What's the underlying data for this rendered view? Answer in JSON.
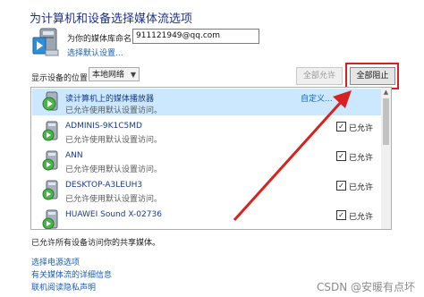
{
  "window": {
    "title": "为计算机和设备选择媒体流选项"
  },
  "library": {
    "name_label": "为你的媒体库命名:",
    "name_value": "911121949@qq.com",
    "default_link": "选择默认设置..."
  },
  "location": {
    "label": "显示设备的位置:",
    "selected": "本地网络"
  },
  "buttons": {
    "allow_all": "全部允许",
    "block_all": "全部阻止"
  },
  "devices": [
    {
      "name": "读计算机上的媒体播放器",
      "status": "已允许使用默认设置访问。",
      "action": "自定义...",
      "selected": true
    },
    {
      "name": "ADMINIS-9K1C5MD",
      "status": "已允许使用默认设置访问。",
      "checkbox_label": "已允许",
      "checked": true
    },
    {
      "name": "ANN",
      "status": "已允许使用默认设置访问。",
      "checkbox_label": "已允许",
      "checked": true
    },
    {
      "name": "DESKTOP-A3LEUH3",
      "status": "已允许使用默认设置访问。",
      "checkbox_label": "已允许",
      "checked": true
    },
    {
      "name": "HUAWEI Sound X-02736",
      "status": "",
      "checkbox_label": "已允许",
      "checked": true
    }
  ],
  "footer": {
    "status": "已允许所有设备访问你的共享媒体。",
    "links": [
      "选择电源选项",
      "有关媒体流的详细信息",
      "联机阅读隐私声明"
    ]
  },
  "watermark": "CSDN @安暖有点坏",
  "colors": {
    "highlight_red": "#d8221f",
    "selected_row": "#cce8ff",
    "link_blue": "#1a5fb4",
    "title_blue": "#1e3287"
  }
}
